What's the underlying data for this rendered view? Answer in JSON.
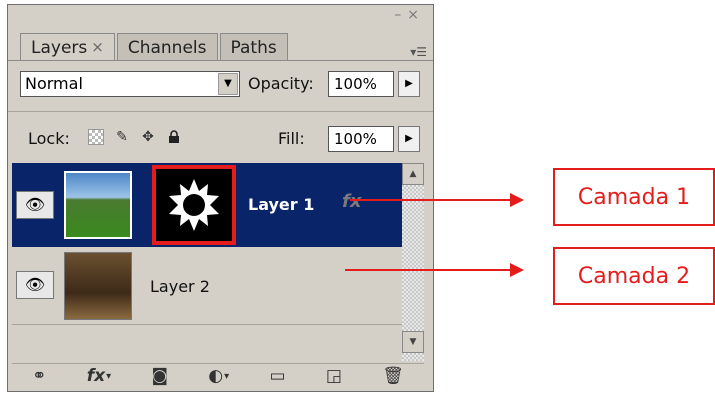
{
  "window": {
    "minimize": "–",
    "close": "×"
  },
  "tabs": [
    {
      "label": "Layers",
      "close": "×"
    },
    {
      "label": "Channels"
    },
    {
      "label": "Paths"
    }
  ],
  "panel_menu_icon": "panel-menu-icon",
  "blend": {
    "mode": "Normal",
    "opacity_label": "Opacity:",
    "opacity_value": "100%"
  },
  "lock": {
    "label": "Lock:",
    "fill_label": "Fill:",
    "fill_value": "100%"
  },
  "layers": [
    {
      "name": "Layer 1",
      "selected": true,
      "has_mask": true,
      "fx": "fx"
    },
    {
      "name": "Layer 2",
      "selected": false
    }
  ],
  "bottom_icons": [
    "link-icon",
    "fx-icon",
    "add-mask-icon",
    "adjustment-layer-icon",
    "new-group-icon",
    "new-layer-icon",
    "trash-icon"
  ],
  "bottom_fx_label": "fx",
  "annotations": [
    {
      "label": "Camada 1"
    },
    {
      "label": "Camada 2"
    }
  ],
  "colors": {
    "selection": "#0a246a",
    "annotation": "#e51c1c",
    "panel": "#d4d0c8"
  }
}
